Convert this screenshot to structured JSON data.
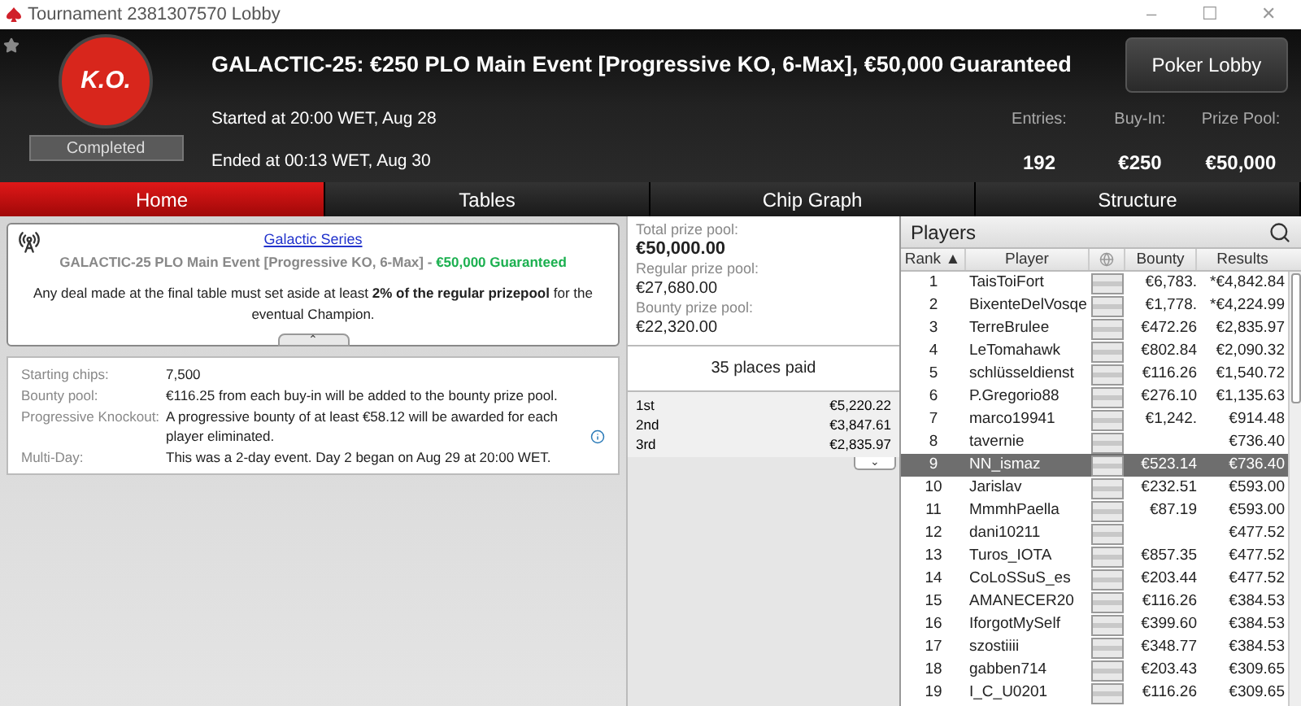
{
  "window": {
    "title": "Tournament 2381307570 Lobby",
    "controls": [
      "–",
      "☐",
      "✕"
    ]
  },
  "header": {
    "badge": "K.O.",
    "status": "Completed",
    "title": "GALACTIC-25: €250 PLO Main Event [Progressive KO, 6-Max], €50,000 Guaranteed",
    "started": "Started at 20:00 WET, Aug 28",
    "ended": "Ended at 00:13 WET, Aug 30",
    "lobby_button": "Poker Lobby",
    "stats": [
      {
        "label": "Entries:",
        "value": "192"
      },
      {
        "label": "Buy-In:",
        "value": "€250"
      },
      {
        "label": "Prize Pool:",
        "value": "€50,000"
      }
    ]
  },
  "tabs": [
    {
      "label": "Home",
      "selected": true
    },
    {
      "label": "Tables",
      "selected": false
    },
    {
      "label": "Chip Graph",
      "selected": false
    },
    {
      "label": "Structure",
      "selected": false
    }
  ],
  "notice": {
    "link": "Galactic Series",
    "event": "GALACTIC-25 PLO Main Event [Progressive KO, 6-Max]",
    "separator": " - ",
    "guarantee": "€50,000 Guaranteed",
    "text": "Any deal made at the final table must set aside at least **2% of the regular prizepool** for the eventual Champion.",
    "collapse": "⌃"
  },
  "details": [
    {
      "label": "Starting chips:",
      "value": "7,500",
      "info": false
    },
    {
      "label": "Bounty pool:",
      "value": "€116.25 from each buy-in will be added to the bounty prize pool.",
      "info": false
    },
    {
      "label": "Progressive Knockout:",
      "value": "A progressive bounty of at least €58.12 will be awarded for each player eliminated.",
      "info": true
    },
    {
      "label": "Multi-Day:",
      "value": "This was a 2-day event. Day 2 began on Aug 29 at 20:00 WET.",
      "info": false
    }
  ],
  "prizes": {
    "pools": [
      {
        "label": "Total prize pool:",
        "value": "€50,000.00",
        "main": true
      },
      {
        "label": "Regular prize pool:",
        "value": "€27,680.00",
        "main": false
      },
      {
        "label": "Bounty prize pool:",
        "value": "€22,320.00",
        "main": false
      }
    ],
    "paid": "35 places paid",
    "places": [
      {
        "place": "1st",
        "amount": "€5,220.22"
      },
      {
        "place": "2nd",
        "amount": "€3,847.61"
      },
      {
        "place": "3rd",
        "amount": "€2,835.97"
      }
    ],
    "expand": "⌄"
  },
  "players": {
    "title": "Players",
    "columns": [
      "Rank ▲",
      "Player",
      "Bounty",
      "Results"
    ],
    "rows": [
      {
        "rank": "1",
        "name": "TaisToiFort",
        "bounty": "€6,783.",
        "result": "*€4,842.84",
        "selected": false
      },
      {
        "rank": "2",
        "name": "BixenteDelVosqe",
        "bounty": "€1,778.",
        "result": "*€4,224.99",
        "selected": false
      },
      {
        "rank": "3",
        "name": "TerreBrulee",
        "bounty": "€472.26",
        "result": "€2,835.97",
        "selected": false
      },
      {
        "rank": "4",
        "name": "LeTomahawk",
        "bounty": "€802.84",
        "result": "€2,090.32",
        "selected": false
      },
      {
        "rank": "5",
        "name": "schlüsseldienst",
        "bounty": "€116.26",
        "result": "€1,540.72",
        "selected": false
      },
      {
        "rank": "6",
        "name": "P.Gregorio88",
        "bounty": "€276.10",
        "result": "€1,135.63",
        "selected": false
      },
      {
        "rank": "7",
        "name": "marco19941",
        "bounty": "€1,242.",
        "result": "€914.48",
        "selected": false
      },
      {
        "rank": "8",
        "name": "tavernie",
        "result": "€736.40",
        "selected": false
      },
      {
        "rank": "9",
        "name": "NN_ismaz",
        "bounty": "€523.14",
        "result": "€736.40",
        "selected": true
      },
      {
        "rank": "10",
        "name": "Jarislav",
        "bounty": "€232.51",
        "result": "€593.00",
        "selected": false
      },
      {
        "rank": "11",
        "name": "MmmhPaella",
        "bounty": "€87.19",
        "result": "€593.00",
        "selected": false
      },
      {
        "rank": "12",
        "name": "dani10211",
        "result": "€477.52",
        "selected": false
      },
      {
        "rank": "13",
        "name": "Turos_IOTA",
        "bounty": "€857.35",
        "result": "€477.52",
        "selected": false
      },
      {
        "rank": "14",
        "name": "CoLoSSuS_es",
        "bounty": "€203.44",
        "result": "€477.52",
        "selected": false
      },
      {
        "rank": "15",
        "name": "AMANECER20",
        "bounty": "€116.26",
        "result": "€384.53",
        "selected": false
      },
      {
        "rank": "16",
        "name": "IforgotMySelf",
        "bounty": "€399.60",
        "result": "€384.53",
        "selected": false
      },
      {
        "rank": "17",
        "name": "szostiiii",
        "bounty": "€348.77",
        "result": "€384.53",
        "selected": false
      },
      {
        "rank": "18",
        "name": "gabben714",
        "bounty": "€203.43",
        "result": "€309.65",
        "selected": false
      },
      {
        "rank": "19",
        "name": "I_C_U0201",
        "bounty": "€116.26",
        "result": "€309.65",
        "selected": false
      }
    ]
  }
}
